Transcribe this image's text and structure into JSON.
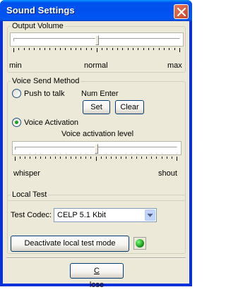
{
  "window": {
    "title": "Sound Settings"
  },
  "output_volume": {
    "group_label": "Output Volume",
    "min_label": "min",
    "mid_label": "normal",
    "max_label": "max",
    "level": 0.5
  },
  "voice_send": {
    "group_label": "Voice Send Method",
    "push_to_talk": {
      "label": "Push to talk",
      "selected": false
    },
    "hotkey_value": "Num Enter",
    "set_label": "Set",
    "clear_label": "Clear",
    "voice_activation": {
      "label": "Voice Activation",
      "selected": true
    },
    "level_label": "Voice activation level",
    "level_min_label": "whisper",
    "level_max_label": "shout",
    "level": 0.5
  },
  "local_test": {
    "group_label": "Local Test",
    "codec_label": "Test Codec:",
    "codec_value": "CELP 5.1 Kbit",
    "deactivate_label": "Deactivate local test mode",
    "status_color": "#1d9a1d"
  },
  "footer": {
    "close_label": "Close"
  },
  "colors": {
    "titlebar": "#0053ee",
    "window_bg": "#ece9d8",
    "led": "#1d9a1d"
  }
}
